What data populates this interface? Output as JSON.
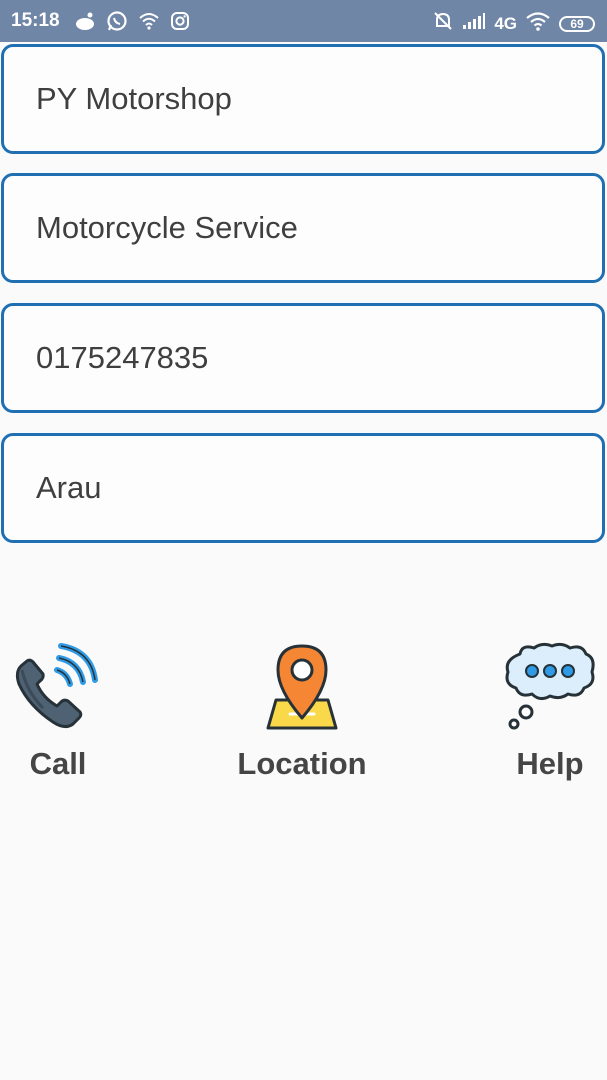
{
  "status_bar": {
    "time": "15:18",
    "network": "4G",
    "battery": "69"
  },
  "fields": [
    {
      "value": "PY Motorshop"
    },
    {
      "value": "Motorcycle Service"
    },
    {
      "value": "0175247835"
    },
    {
      "value": "Arau"
    }
  ],
  "actions": {
    "call_label": "Call",
    "location_label": "Location",
    "help_label": "Help"
  },
  "colors": {
    "status_bar": "#6f86a6",
    "field_border": "#1f6fb2",
    "pin_orange": "#f58634",
    "map_yellow": "#f9d84a",
    "wave_blue": "#2f9be6"
  }
}
